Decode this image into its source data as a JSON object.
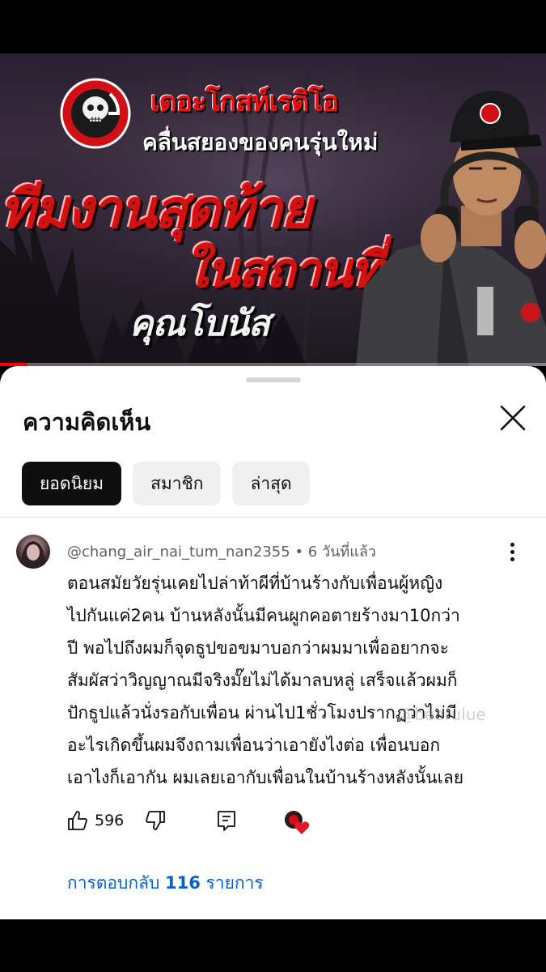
{
  "video": {
    "brand": "เดอะโกสท์เรดิโอ",
    "tagline": "คลื่นสยองของคนรุ่นใหม่",
    "title_line1": "ทีมงานสุดท้าย",
    "title_line2": "ในสถานที่เดิม",
    "guest": "คุณโบนัส",
    "progress": 0.05
  },
  "sheet": {
    "title": "ความคิดเห็น",
    "close_icon": "close-icon"
  },
  "tabs": [
    {
      "label": "ยอดนิยม",
      "active": true
    },
    {
      "label": "สมาชิก",
      "active": false
    },
    {
      "label": "ล่าสุด",
      "active": false
    }
  ],
  "comment": {
    "author": "@chang_air_nai_tum_nan2355",
    "time": "6 วันที่แล้ว",
    "lines": [
      "ตอนสมัยวัยรุ่นเคยไปล่าท้าผีที่บ้านร้างกับเพื่อนผู้หญิง",
      "ไปกันแค่2คน บ้านหลังนั้นมีคนผูกคอตายร้างมา10กว่า",
      "ปี พอไปถึงผมก็จุดธูปขอขมาบอกว่าผมมาเพื่ออยากจะ",
      "สัมผัสว่าวิญญาณมีจริงมั๊ยไม่ได้มาลบหลู่ เสร็จแล้วผมก็",
      "ปักธูปแล้วนั่งรอกับเพื่อน ผ่านไป1ชั่วโมงปรากฏว่าไม่มี",
      "อะไรเกิดขึ้นผมจึงถามเพื่อนว่าเอายังไงต่อ เพื่อนบอก",
      "เอาไงก็เอากัน ผมเลยเอากับเพื่อนในบ้านร้างหลังนั้นเลย"
    ],
    "likes": "596",
    "watermark": "@bearulue",
    "replies_prefix": "การตอบกลับ",
    "replies_count": "116",
    "replies_suffix": "รายการ"
  },
  "colors": {
    "accent_link": "#065fd4",
    "chip_active": "#0f0f0f",
    "heart": "#e3162d"
  }
}
